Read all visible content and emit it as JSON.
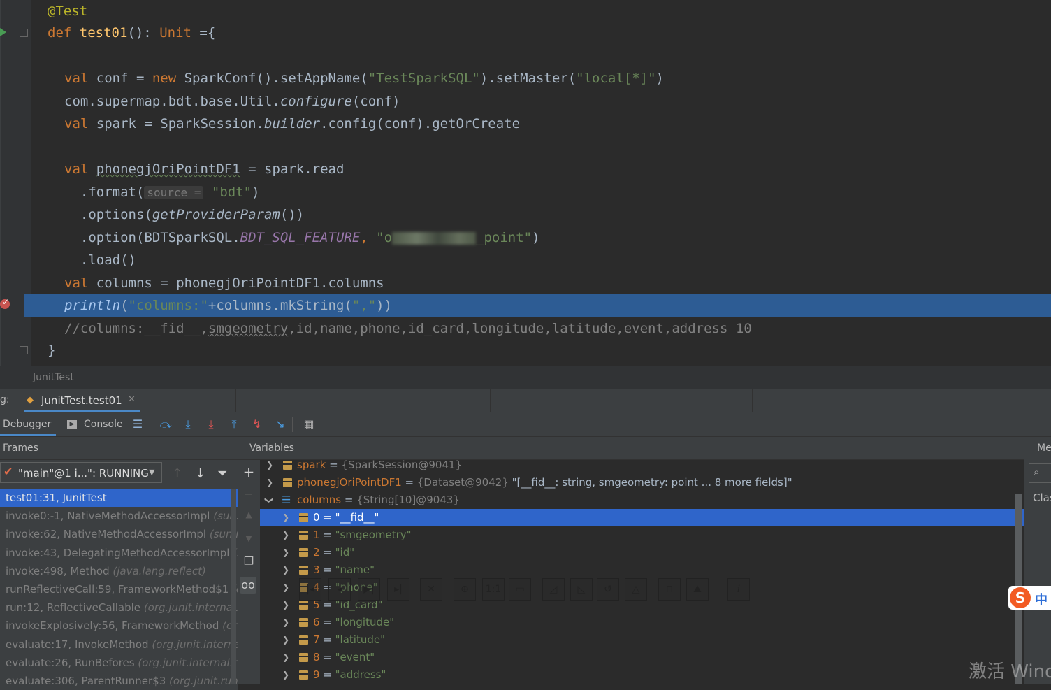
{
  "editor": {
    "annotation": "@Test",
    "def_kw": "def",
    "fn_name": "test01",
    "sig_rest": "(): ",
    "unit_kw": "Unit",
    "sig_end": " ={",
    "line_conf_val": "val",
    "line_conf_a": " conf = ",
    "line_conf_new": "new",
    "line_conf_b": " SparkConf().setAppName(",
    "line_conf_s1": "\"TestSparkSQL\"",
    "line_conf_c": ").setMaster(",
    "line_conf_s2": "\"local[*]\"",
    "line_conf_d": ")",
    "line_util_a": "com.supermap.bdt.base.Util.",
    "line_util_it": "configure",
    "line_util_b": "(conf)",
    "line_spark_val": "val",
    "line_spark_a": " spark = SparkSession.",
    "line_spark_it": "builder",
    "line_spark_b": ".config(conf).getOrCreate",
    "line_df_val": "val",
    "line_df_a": " ",
    "line_df_var": "phonegjOriPointDF1",
    "line_df_b": " = spark.read",
    "line_format_a": "  .format(",
    "line_format_hint": "source =",
    "line_format_s": "\"bdt\"",
    "line_format_b": ")",
    "line_options_a": "  .options(",
    "line_options_it": "getProviderParam",
    "line_options_b": "())",
    "line_option_a": "  .option(BDTSparkSQL.",
    "line_option_const": "BDT_SQL_FEATURE",
    "line_option_comma": ", ",
    "line_option_s1": "\"o",
    "line_option_s2": "_point\"",
    "line_option_b": ")",
    "line_load": "  .load()",
    "line_cols_val": "val",
    "line_cols_a": " columns = phonegjOriPointDF1.columns",
    "line_println_fn": "println",
    "line_println_a": "(",
    "line_println_s1": "\"columns:\"",
    "line_println_b": "+columns.mkString(",
    "line_println_s2": "\",\"",
    "line_println_c": "))",
    "line_comment_a": "//columns:__fid__,",
    "line_comment_sq": "smgeometry",
    "line_comment_b": ",id,name,phone,id_card,longitude,latitude,event,address 10",
    "close_brace": "}"
  },
  "breadcrumb": "JunitTest",
  "debug_tabs": {
    "label": "g:",
    "session_tab": "JunitTest.test01"
  },
  "toolbar": {
    "debugger_tab": "Debugger",
    "console_tab": "Console"
  },
  "frames": {
    "header": "Frames",
    "thread": "\"main\"@1 i...\": RUNNING",
    "items": [
      {
        "m": "test01:31, JunitTest",
        "p": ""
      },
      {
        "m": "invoke0:-1, NativeMethodAccessorImpl",
        "p": "(sun.r"
      },
      {
        "m": "invoke:62, NativeMethodAccessorImpl",
        "p": "(sun.re"
      },
      {
        "m": "invoke:43, DelegatingMethodAccessorImpl",
        "p": "(s"
      },
      {
        "m": "invoke:498, Method",
        "p": "(java.lang.reflect)"
      },
      {
        "m": "runReflectiveCall:59, FrameworkMethod$1",
        "p": "(o"
      },
      {
        "m": "run:12, ReflectiveCallable",
        "p": "(org.junit.internal.ru"
      },
      {
        "m": "invokeExplosively:56, FrameworkMethod",
        "p": "(org"
      },
      {
        "m": "evaluate:17, InvokeMethod",
        "p": "(org.junit.internal."
      },
      {
        "m": "evaluate:26, RunBefores",
        "p": "(org.junit.internal.run"
      },
      {
        "m": "evaluate:306, ParentRunner$3",
        "p": "(org.junit.runne"
      }
    ]
  },
  "variables": {
    "header": "Variables",
    "spark": {
      "name": "spark",
      "value": "{SparkSession@9041}"
    },
    "df": {
      "name": "phonegjOriPointDF1",
      "value": "{Dataset@9042}",
      "desc": "\"[__fid__: string, smgeometry: point ... 8 more fields]\""
    },
    "columns": {
      "name": "columns",
      "value": "{String[10]@9043}"
    },
    "items": [
      {
        "i": "0",
        "v": "\"__fid__\""
      },
      {
        "i": "1",
        "v": "\"smgeometry\""
      },
      {
        "i": "2",
        "v": "\"id\""
      },
      {
        "i": "3",
        "v": "\"name\""
      },
      {
        "i": "4",
        "v": "\"phone\""
      },
      {
        "i": "5",
        "v": "\"id_card\""
      },
      {
        "i": "6",
        "v": "\"longitude\""
      },
      {
        "i": "7",
        "v": "\"latitude\""
      },
      {
        "i": "8",
        "v": "\"event\""
      },
      {
        "i": "9",
        "v": "\"address\""
      }
    ],
    "eq": " = "
  },
  "right_panel": {
    "header": "Me",
    "clas": "Clas"
  },
  "overlay": {
    "one_to_one": "1:1",
    "info": "i"
  },
  "ime": {
    "logo": "S",
    "lang": "中"
  },
  "watermark": "激活 Wind",
  "colors": {
    "keyword": "#cc7832",
    "string": "#6a8759",
    "function": "#ffc66d",
    "selection": "#2d5c94",
    "accent": "#4a88c7"
  }
}
